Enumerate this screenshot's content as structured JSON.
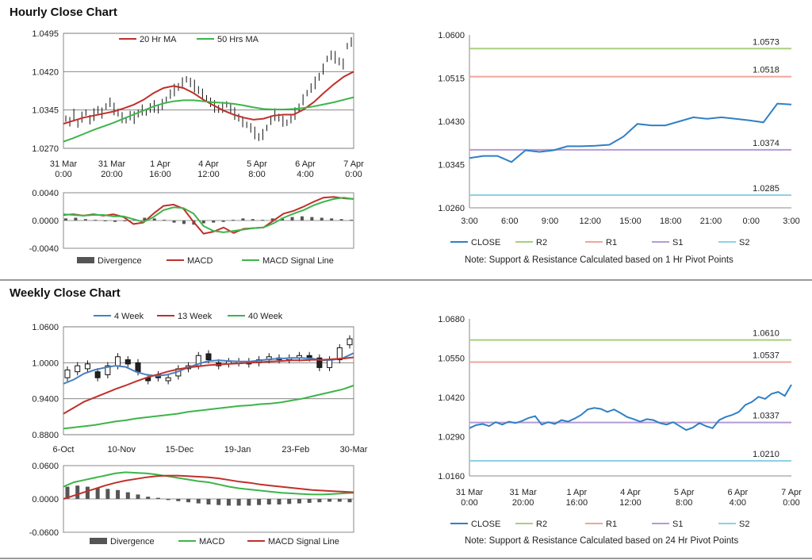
{
  "titles": {
    "hourly": "Hourly Close Chart",
    "weekly": "Weekly Close Chart"
  },
  "notes": {
    "hourly": "Note: Support & Resistance Calculated based on 1 Hr Pivot Points",
    "weekly": "Note: Support & Resistance Calculated based on 24 Hr Pivot Points"
  },
  "colors": {
    "ma20": "#c0302b",
    "ma50": "#3cb54a",
    "ma4": "#4a7fc0",
    "close": "#2f80c4",
    "r2": "#a9cf7e",
    "r1": "#f0a49c",
    "s1": "#b59ad4",
    "s2": "#8fd0e6",
    "divergence": "#555555",
    "grid": "#777777"
  },
  "chart_data": [
    {
      "id": "hourly-price",
      "type": "line",
      "legend": [
        "20 Hr MA",
        "50 Hrs MA"
      ],
      "yticks": [
        "1.0495",
        "1.0420",
        "1.0345",
        "1.0270"
      ],
      "ylim": [
        1.027,
        1.0495
      ],
      "xticks": [
        [
          "31 Mar",
          "0:00"
        ],
        [
          "31 Mar",
          "20:00"
        ],
        [
          "1 Apr",
          "16:00"
        ],
        [
          "4 Apr",
          "12:00"
        ],
        [
          "5 Apr",
          "8:00"
        ],
        [
          "6 Apr",
          "4:00"
        ],
        [
          "7 Apr",
          "0:00"
        ]
      ],
      "candles": [
        1.0328,
        1.0322,
        1.0335,
        1.0318,
        1.0331,
        1.034,
        1.0326,
        1.0336,
        1.0345,
        1.0339,
        1.0352,
        1.036,
        1.0347,
        1.034,
        1.033,
        1.0325,
        1.0334,
        1.033,
        1.0338,
        1.0345,
        1.034,
        1.0349,
        1.0352,
        1.0346,
        1.0356,
        1.0365,
        1.0376,
        1.0384,
        1.039,
        1.0398,
        1.0405,
        1.0399,
        1.0392,
        1.0384,
        1.0376,
        1.0368,
        1.036,
        1.0352,
        1.0347,
        1.035,
        1.0356,
        1.0348,
        1.0338,
        1.033,
        1.0322,
        1.0316,
        1.031,
        1.03,
        1.0292,
        1.0297,
        1.031,
        1.0325,
        1.0336,
        1.033,
        1.0323,
        1.032,
        1.0328,
        1.0338,
        1.035,
        1.0365,
        1.0378,
        1.0388,
        1.0398,
        1.041,
        1.0425,
        1.0445,
        1.0452,
        1.0448,
        1.044,
        1.0435,
        1.047,
        1.0478
      ],
      "series": [
        {
          "name": "20 Hr MA",
          "values": [
            1.0318,
            1.0324,
            1.033,
            1.0334,
            1.0338,
            1.0342,
            1.0348,
            1.0355,
            1.0365,
            1.0378,
            1.0388,
            1.0392,
            1.0388,
            1.0378,
            1.0365,
            1.0354,
            1.0344,
            1.0336,
            1.033,
            1.0326,
            1.0328,
            1.0334,
            1.0336,
            1.0336,
            1.0346,
            1.036,
            1.0378,
            1.0395,
            1.041,
            1.042
          ]
        },
        {
          "name": "50 Hrs MA",
          "values": [
            1.0283,
            1.029,
            1.0298,
            1.0306,
            1.0313,
            1.032,
            1.0328,
            1.0336,
            1.0344,
            1.0352,
            1.0358,
            1.0362,
            1.0364,
            1.0364,
            1.0362,
            1.036,
            1.0359,
            1.0357,
            1.0354,
            1.035,
            1.0347,
            1.0346,
            1.0346,
            1.0347,
            1.0349,
            1.0352,
            1.0356,
            1.036,
            1.0365,
            1.037
          ]
        }
      ]
    },
    {
      "id": "hourly-macd",
      "type": "line",
      "legend": [
        "Divergence",
        "MACD",
        "MACD Signal Line"
      ],
      "yticks": [
        "0.0040",
        "0.0000",
        "-0.0040"
      ],
      "ylim": [
        -0.004,
        0.004
      ],
      "divergence": [
        0.0003,
        0.0004,
        0.0002,
        0.0001,
        -0.0001,
        -0.0002,
        -0.0001,
        0.0002,
        0.0004,
        0.0003,
        0.0001,
        -0.0003,
        -0.0005,
        -0.0006,
        -0.0004,
        -0.0003,
        -0.0002,
        0.0001,
        0.0003,
        0.0002,
        0.0001,
        0.0003,
        0.0004,
        0.0005,
        0.0006,
        0.0005,
        0.0004,
        0.0003,
        0.0002,
        0.0001
      ],
      "series": [
        {
          "name": "MACD",
          "values": [
            0.0008,
            0.0009,
            0.0007,
            0.0009,
            0.0007,
            0.0009,
            0.0005,
            -0.0005,
            -0.0003,
            0.001,
            0.0021,
            0.0023,
            0.0017,
            -0.0002,
            -0.0019,
            -0.0016,
            -0.001,
            -0.0018,
            -0.0012,
            -0.0011,
            -0.001,
            0.0,
            0.001,
            0.0014,
            0.002,
            0.0027,
            0.0033,
            0.0034,
            0.0032,
            0.0031
          ]
        },
        {
          "name": "MACD Signal Line",
          "values": [
            0.0009,
            0.0008,
            0.0007,
            0.0008,
            0.0008,
            0.0006,
            0.0006,
            0.0002,
            -0.0002,
            0.0005,
            0.0015,
            0.0019,
            0.0018,
            0.001,
            -0.0008,
            -0.0015,
            -0.0017,
            -0.0015,
            -0.0013,
            -0.0011,
            -0.001,
            -0.0004,
            0.0004,
            0.001,
            0.0015,
            0.0022,
            0.0027,
            0.0031,
            0.0033,
            0.0031
          ]
        }
      ]
    },
    {
      "id": "hourly-sr",
      "type": "line",
      "legend": [
        "CLOSE",
        "R2",
        "R1",
        "S1",
        "S2"
      ],
      "yticks": [
        "1.0600",
        "1.0515",
        "1.0430",
        "1.0345",
        "1.0260"
      ],
      "ylim": [
        1.026,
        1.06
      ],
      "xticks": [
        "3:00",
        "6:00",
        "9:00",
        "12:00",
        "15:00",
        "18:00",
        "21:00",
        "0:00",
        "3:00"
      ],
      "levels": [
        {
          "name": "R2",
          "value": 1.0573,
          "label": "1.0573"
        },
        {
          "name": "R1",
          "value": 1.0518,
          "label": "1.0518"
        },
        {
          "name": "S1",
          "value": 1.0374,
          "label": "1.0374"
        },
        {
          "name": "S2",
          "value": 1.0285,
          "label": "1.0285"
        }
      ],
      "series": [
        {
          "name": "CLOSE",
          "values": [
            1.0358,
            1.0362,
            1.0362,
            1.035,
            1.0373,
            1.037,
            1.0373,
            1.0381,
            1.0381,
            1.0382,
            1.0384,
            1.04,
            1.0425,
            1.0422,
            1.0422,
            1.043,
            1.0438,
            1.0435,
            1.0438,
            1.0435,
            1.0432,
            1.0428,
            1.0465,
            1.0463
          ]
        }
      ]
    },
    {
      "id": "weekly-price",
      "type": "line",
      "legend": [
        "4 Week",
        "13 Week",
        "40 Week"
      ],
      "yticks": [
        "1.0600",
        "1.0000",
        "0.9400",
        "0.8800"
      ],
      "ylim": [
        0.88,
        1.06
      ],
      "xticks": [
        "6-Oct",
        "10-Nov",
        "15-Dec",
        "19-Jan",
        "23-Feb",
        "30-Mar"
      ],
      "candles": [
        [
          0.975,
          0.988
        ],
        [
          0.985,
          0.995
        ],
        [
          0.99,
          0.998
        ],
        [
          0.985,
          0.975
        ],
        [
          0.98,
          0.995
        ],
        [
          0.995,
          1.01
        ],
        [
          1.005,
          0.998
        ],
        [
          1.0,
          0.985
        ],
        [
          0.975,
          0.97
        ],
        [
          0.98,
          0.975
        ],
        [
          0.97,
          0.975
        ],
        [
          0.978,
          0.99
        ],
        [
          0.99,
          0.995
        ],
        [
          0.995,
          1.012
        ],
        [
          1.015,
          1.005
        ],
        [
          1.0,
          0.995
        ],
        [
          0.998,
          1.002
        ],
        [
          1.0,
          1.002
        ],
        [
          1.002,
          0.998
        ],
        [
          1.0,
          1.005
        ],
        [
          1.005,
          1.01
        ],
        [
          1.008,
          1.005
        ],
        [
          1.005,
          1.008
        ],
        [
          1.008,
          1.012
        ],
        [
          1.012,
          1.008
        ],
        [
          1.008,
          0.992
        ],
        [
          0.992,
          1.005
        ],
        [
          1.005,
          1.025
        ],
        [
          1.03,
          1.04
        ]
      ],
      "series": [
        {
          "name": "4 Week",
          "values": [
            0.965,
            0.972,
            0.982,
            0.988,
            0.992,
            0.995,
            0.993,
            0.985,
            0.98,
            0.978,
            0.98,
            0.985,
            0.992,
            0.998,
            1.003,
            1.004,
            1.003,
            1.002,
            1.002,
            1.004,
            1.006,
            1.007,
            1.008,
            1.008,
            1.007,
            1.004,
            1.005,
            1.008,
            1.016
          ]
        },
        {
          "name": "13 Week",
          "values": [
            0.915,
            0.925,
            0.935,
            0.942,
            0.949,
            0.956,
            0.962,
            0.969,
            0.975,
            0.98,
            0.985,
            0.989,
            0.992,
            0.994,
            0.996,
            0.997,
            0.998,
            0.999,
            1.0,
            1.001,
            1.002,
            1.003,
            1.004,
            1.004,
            1.005,
            1.005,
            1.006,
            1.007,
            1.009
          ]
        },
        {
          "name": "40 Week",
          "values": [
            0.89,
            0.892,
            0.894,
            0.896,
            0.899,
            0.902,
            0.904,
            0.907,
            0.909,
            0.911,
            0.913,
            0.915,
            0.918,
            0.92,
            0.922,
            0.924,
            0.926,
            0.928,
            0.929,
            0.931,
            0.932,
            0.934,
            0.937,
            0.94,
            0.944,
            0.948,
            0.952,
            0.956,
            0.962
          ]
        }
      ]
    },
    {
      "id": "weekly-macd",
      "type": "line",
      "legend": [
        "Divergence",
        "MACD",
        "MACD Signal Line"
      ],
      "yticks": [
        "0.0600",
        "0.0000",
        "-0.0600"
      ],
      "ylim": [
        -0.06,
        0.06
      ],
      "divergence": [
        0.022,
        0.024,
        0.022,
        0.02,
        0.018,
        0.016,
        0.012,
        0.008,
        0.004,
        0.002,
        -0.002,
        -0.004,
        -0.006,
        -0.008,
        -0.01,
        -0.011,
        -0.012,
        -0.012,
        -0.012,
        -0.011,
        -0.01,
        -0.01,
        -0.009,
        -0.008,
        -0.007,
        -0.006,
        -0.005,
        -0.005,
        -0.006
      ],
      "series": [
        {
          "name": "MACD",
          "values": [
            0.022,
            0.03,
            0.034,
            0.038,
            0.042,
            0.046,
            0.048,
            0.047,
            0.046,
            0.044,
            0.041,
            0.038,
            0.035,
            0.032,
            0.03,
            0.026,
            0.022,
            0.019,
            0.017,
            0.015,
            0.013,
            0.011,
            0.01,
            0.009,
            0.008,
            0.008,
            0.009,
            0.01,
            0.011
          ]
        },
        {
          "name": "MACD Signal Line",
          "values": [
            0.0,
            0.006,
            0.012,
            0.018,
            0.024,
            0.029,
            0.033,
            0.036,
            0.039,
            0.041,
            0.042,
            0.042,
            0.041,
            0.04,
            0.039,
            0.037,
            0.034,
            0.031,
            0.029,
            0.026,
            0.024,
            0.022,
            0.02,
            0.018,
            0.016,
            0.015,
            0.014,
            0.013,
            0.012
          ]
        }
      ]
    },
    {
      "id": "weekly-sr",
      "type": "line",
      "legend": [
        "CLOSE",
        "R2",
        "R1",
        "S1",
        "S2"
      ],
      "yticks": [
        "1.0680",
        "1.0550",
        "1.0420",
        "1.0290",
        "1.0160"
      ],
      "ylim": [
        1.016,
        1.068
      ],
      "xticks": [
        [
          "31 Mar",
          "0:00"
        ],
        [
          "31 Mar",
          "20:00"
        ],
        [
          "1 Apr",
          "16:00"
        ],
        [
          "4 Apr",
          "12:00"
        ],
        [
          "5 Apr",
          "8:00"
        ],
        [
          "6 Apr",
          "4:00"
        ],
        [
          "7 Apr",
          "0:00"
        ]
      ],
      "levels": [
        {
          "name": "R2",
          "value": 1.061,
          "label": "1.0610"
        },
        {
          "name": "R1",
          "value": 1.0537,
          "label": "1.0537"
        },
        {
          "name": "S1",
          "value": 1.0337,
          "label": "1.0337"
        },
        {
          "name": "S2",
          "value": 1.021,
          "label": "1.0210"
        }
      ],
      "series": [
        {
          "name": "CLOSE",
          "values": [
            1.0318,
            1.0328,
            1.0332,
            1.0325,
            1.0338,
            1.033,
            1.034,
            1.0335,
            1.0342,
            1.0352,
            1.0358,
            1.033,
            1.0338,
            1.0332,
            1.0345,
            1.034,
            1.035,
            1.0362,
            1.038,
            1.0385,
            1.0382,
            1.0372,
            1.038,
            1.0368,
            1.0355,
            1.0348,
            1.034,
            1.0348,
            1.0345,
            1.0335,
            1.033,
            1.0338,
            1.0325,
            1.0312,
            1.032,
            1.0335,
            1.0325,
            1.0318,
            1.0345,
            1.0355,
            1.0362,
            1.0372,
            1.0395,
            1.0405,
            1.0422,
            1.0415,
            1.0432,
            1.0438,
            1.0425,
            1.0462
          ]
        }
      ]
    }
  ]
}
